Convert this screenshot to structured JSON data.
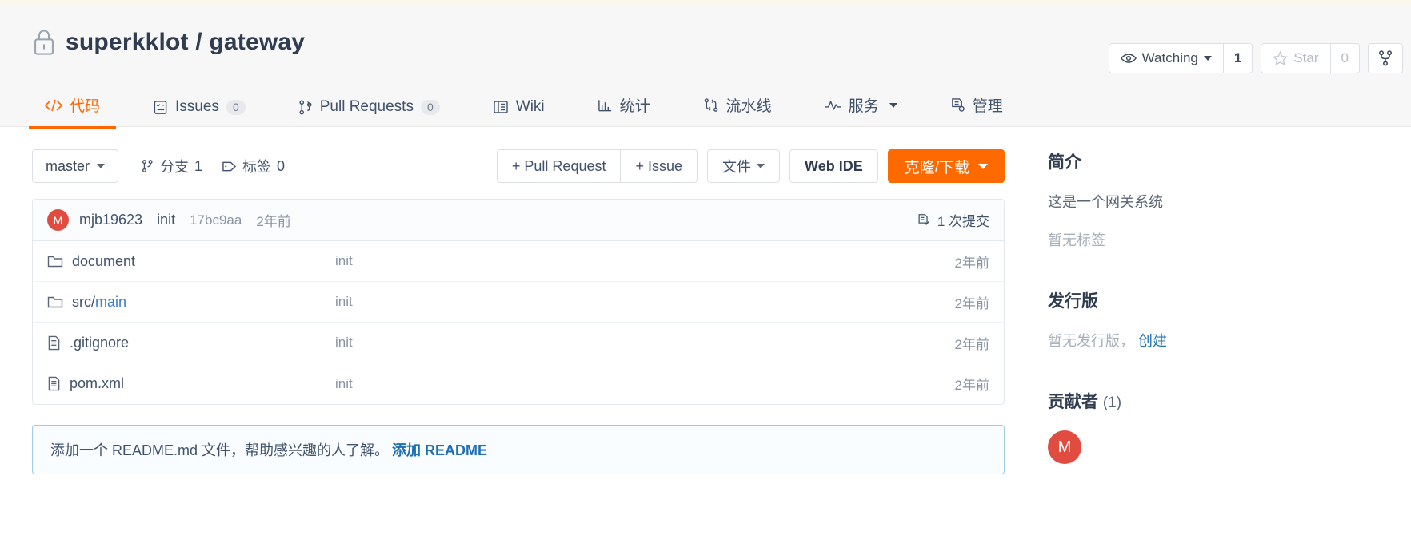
{
  "repo": {
    "owner": "superkklot",
    "separator": "/",
    "name": "gateway",
    "visibility_icon": "lock-icon"
  },
  "header_actions": {
    "watch": {
      "label": "Watching",
      "count": "1",
      "icon": "eye-icon"
    },
    "star": {
      "label": "Star",
      "count": "0",
      "icon": "star-icon"
    },
    "fork": {
      "icon": "fork-icon"
    }
  },
  "tabs": [
    {
      "label": "代码",
      "icon": "code-icon",
      "badge": null,
      "active": true
    },
    {
      "label": "Issues",
      "icon": "issue-icon",
      "badge": "0",
      "active": false
    },
    {
      "label": "Pull Requests",
      "icon": "pull-request-icon",
      "badge": "0",
      "active": false
    },
    {
      "label": "Wiki",
      "icon": "book-icon",
      "badge": null,
      "active": false
    },
    {
      "label": "统计",
      "icon": "chart-icon",
      "badge": null,
      "active": false
    },
    {
      "label": "流水线",
      "icon": "pipeline-icon",
      "badge": null,
      "active": false
    },
    {
      "label": "服务",
      "icon": "pulse-icon",
      "badge": null,
      "active": false,
      "caret": true
    },
    {
      "label": "管理",
      "icon": "manage-icon",
      "badge": null,
      "active": false
    }
  ],
  "toolbar": {
    "branch_selector": "master",
    "branches": {
      "label": "分支",
      "count": "1",
      "icon": "branch-icon"
    },
    "tags": {
      "label": "标签",
      "count": "0",
      "icon": "tag-icon"
    },
    "pull_request_button": "+ Pull Request",
    "issue_button": "+ Issue",
    "file_button": "文件",
    "web_ide_button": "Web IDE",
    "clone_button": "克隆/下载"
  },
  "commit_bar": {
    "avatar_initial": "M",
    "author": "mjb19623",
    "message": "init",
    "sha": "17bc9aa",
    "time": "2年前",
    "count_label": "1 次提交",
    "count_icon": "commit-icon"
  },
  "files": [
    {
      "name": "document",
      "type": "folder",
      "icon": "folder-icon",
      "commit": "init",
      "time": "2年前",
      "highlight": null
    },
    {
      "name": "src/",
      "highlight": "main",
      "type": "folder",
      "icon": "folder-icon",
      "commit": "init",
      "time": "2年前"
    },
    {
      "name": ".gitignore",
      "type": "file",
      "icon": "file-icon",
      "commit": "init",
      "time": "2年前",
      "highlight": null
    },
    {
      "name": "pom.xml",
      "type": "file",
      "icon": "file-icon",
      "commit": "init",
      "time": "2年前",
      "highlight": null
    }
  ],
  "readme_prompt": {
    "text": "添加一个 README.md 文件，帮助感兴趣的人了解。",
    "link": "添加 README"
  },
  "sidebar": {
    "about_heading": "简介",
    "about_text": "这是一个网关系统",
    "tags_empty": "暂无标签",
    "releases_heading": "发行版",
    "releases_empty": "暂无发行版，",
    "releases_create": "创建",
    "contributors_heading": "贡献者",
    "contributors_count": "(1)",
    "contributor_initial": "M"
  },
  "colors": {
    "accent": "#ff6600",
    "primary_button": "#ff6a00",
    "text": "#41526b",
    "title": "#303c50",
    "muted": "#8a94a2",
    "link": "#1f6fb2",
    "avatar": "#e14c41"
  }
}
